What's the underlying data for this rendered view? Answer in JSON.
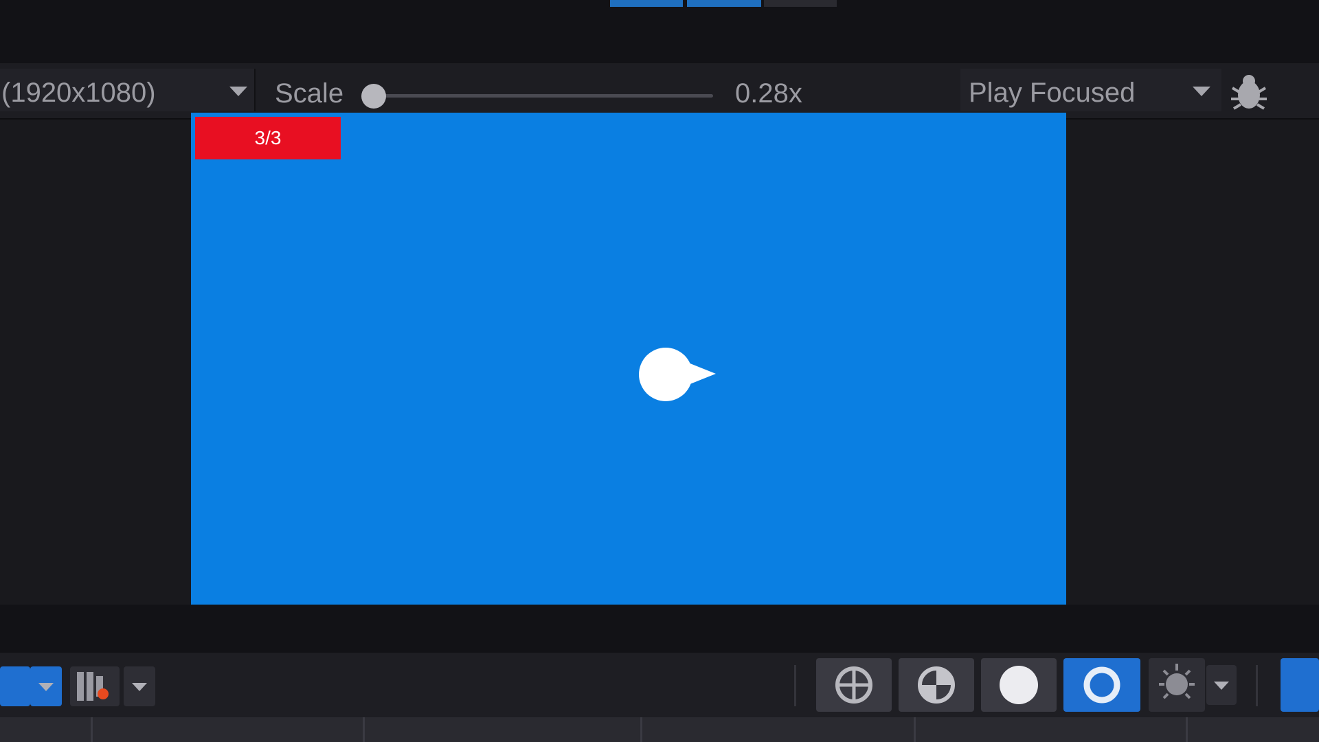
{
  "toolbar": {
    "resolution_label": "(1920x1080)",
    "scale_label": "Scale",
    "scale_value": "0.28x",
    "play_mode_label": "Play Focused"
  },
  "game_view": {
    "background_color": "#0a7fe2",
    "counter_text": "3/3",
    "counter_color": "#e80f22"
  },
  "icons": {
    "resolution_dropdown": "chevron-down-icon",
    "play_mode_dropdown": "chevron-down-icon",
    "bug": "bug-icon",
    "globe": "globe-icon",
    "sphere": "sphere-icon",
    "circle": "circle-icon",
    "ring": "ring-icon",
    "lightbulb": "lightbulb-icon"
  }
}
